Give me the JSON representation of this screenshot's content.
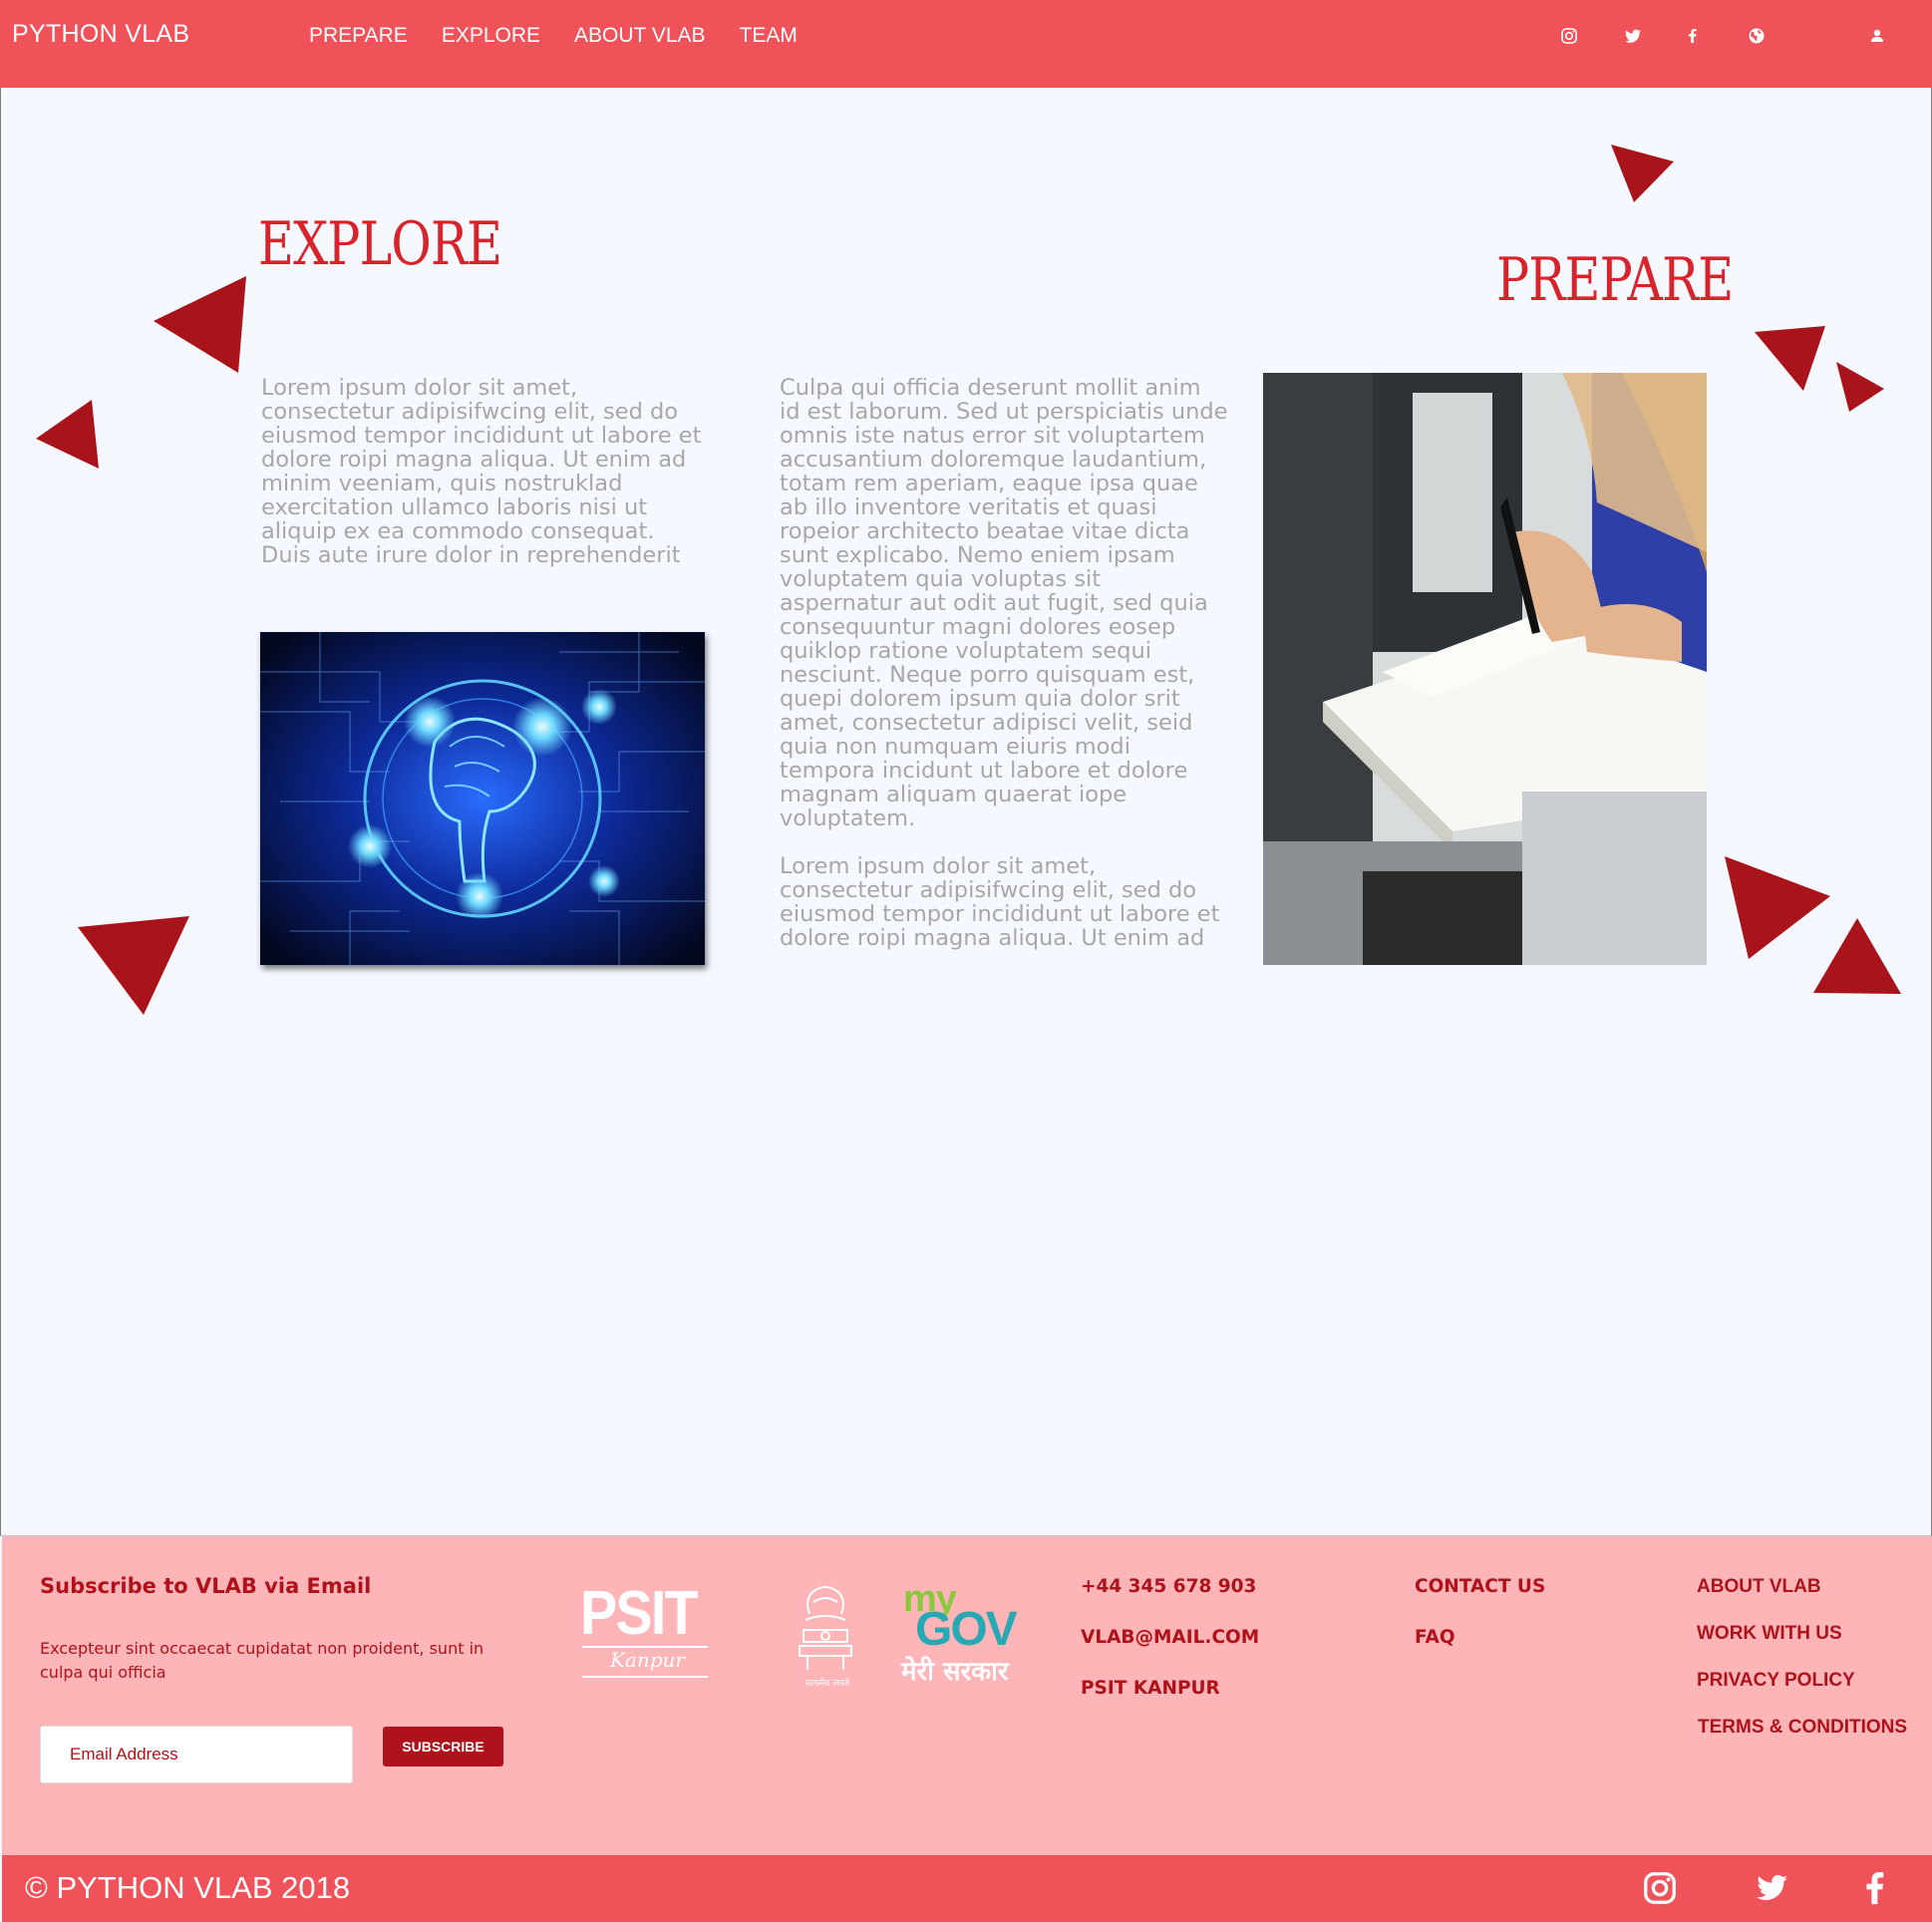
{
  "header": {
    "brand": "PYTHON VLAB",
    "nav": [
      "PREPARE",
      "EXPLORE",
      "ABOUT VLAB",
      "TEAM"
    ],
    "icons": [
      "instagram-icon",
      "twitter-icon",
      "facebook-icon",
      "globe-icon",
      "user-icon"
    ]
  },
  "main": {
    "explore_title": "EXPLORE",
    "prepare_title": "PREPARE",
    "explore_text": "Lorem ipsum dolor sit amet, consectetur adipisifwcing elit, sed do eiusmod tempor incididunt ut labore et dolore roipi magna aliqua. Ut enim ad minim veeniam, quis nostruklad exercitation ullamco laboris nisi ut aliquip ex ea commodo consequat. Duis aute irure dolor in reprehenderit",
    "middle_text_1": "Culpa qui officia deserunt mollit anim id est laborum. Sed ut perspiciatis unde omnis iste natus error sit voluptartem accusantium doloremque laudantium, totam rem aperiam, eaque ipsa quae ab illo inventore veritatis et quasi ropeior architecto beatae vitae dicta sunt explicabo. Nemo eniem ipsam voluptatem quia voluptas sit aspernatur aut odit aut fugit, sed quia consequuntur magni dolores eosep quiklop ratione voluptatem sequi nesciunt. Neque porro quisquam est, quepi dolorem ipsum quia dolor srit amet, consectetur adipisci velit, seid quia non numquam eiuris modi tempora incidunt ut labore et dolore magnam aliquam quaerat iope voluptatem.",
    "middle_text_2": "Lorem ipsum dolor sit amet, consectetur adipisifwcing elit, sed do eiusmod tempor incididunt ut labore et dolore roipi magna aliqua. Ut enim ad"
  },
  "colors": {
    "header": "#f0525a",
    "accent": "#b0121b",
    "title": "#d8232b",
    "triangle": "#a8141a",
    "footer_bg": "#fdb5b8",
    "body_text": "#a7a7a7"
  },
  "footer": {
    "subscribe_title": "Subscribe to VLAB via Email",
    "subscribe_desc": "Excepteur sint occaecat cupidatat non proident, sunt in culpa qui officia",
    "email_placeholder": "Email Address",
    "subscribe_button": "SUBSCRIBE",
    "logos": {
      "psit_main": "PSIT",
      "psit_sub": "Kanpur",
      "emblem_caption": "सत्यमेव जयते",
      "mygov_my": "my",
      "mygov_gov": "GOV",
      "mygov_tagline": "मेरी सरकार"
    },
    "contact": [
      "+44 345 678 903",
      "VLAB@MAIL.COM",
      "PSIT KANPUR"
    ],
    "links_mid": [
      "CONTACT US",
      "FAQ"
    ],
    "links_right": [
      "ABOUT VLAB",
      "WORK WITH US",
      "PRIVACY POLICY",
      "TERMS & CONDITIONS"
    ],
    "copyright": "© PYTHON VLAB 2018",
    "social_icons": [
      "instagram-icon",
      "twitter-icon",
      "facebook-icon"
    ]
  }
}
